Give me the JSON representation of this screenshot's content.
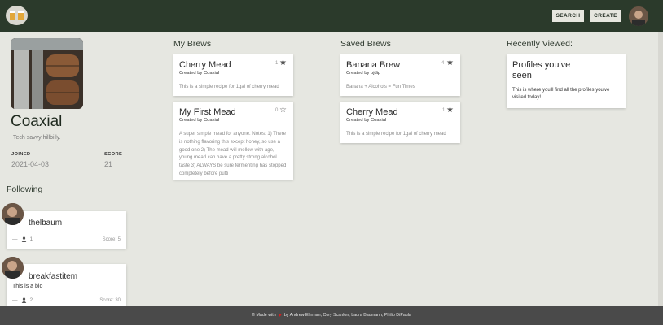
{
  "header": {
    "search_label": "SEARCH",
    "create_label": "CREATE"
  },
  "profile": {
    "username": "Coaxial",
    "bio": "Tech savvy hillbilly.",
    "joined_label": "JOINED",
    "joined_value": "2021-04-03",
    "score_label": "SCORE",
    "score_value": "21"
  },
  "following": {
    "title": "Following",
    "users": [
      {
        "name": "thelbaum",
        "bio": "",
        "followers": "1",
        "score": "Score: 5"
      },
      {
        "name": "breakfastitem",
        "bio": "This is a bio",
        "followers": "2",
        "score": "Score: 30"
      }
    ]
  },
  "my_brews": {
    "title": "My Brews",
    "items": [
      {
        "title": "Cherry Mead",
        "created_by": "Created by Coaxial",
        "description": "This is a simple recipe for 1gal of cherry mead",
        "stars": "1",
        "star_filled": true
      },
      {
        "title": "My First Mead",
        "created_by": "Created by Coaxial",
        "description": "A super simple mead for anyone. Notes: 1) There is nothing flavoring this except honey, so use a good one 2) The mead will mellow with age, young mead can have a pretty strong alcohol taste 3) ALWAYS be sure fermenting has stopped completely before putti",
        "stars": "0",
        "star_filled": false
      }
    ]
  },
  "saved_brews": {
    "title": "Saved Brews",
    "items": [
      {
        "title": "Banana Brew",
        "created_by": "Created by pjdip",
        "description": "Banana + Alcohols = Fun Times",
        "stars": "4",
        "star_filled": true
      },
      {
        "title": "Cherry Mead",
        "created_by": "Created by Coaxial",
        "description": "This is a simple recipe for 1gal of cherry mead",
        "stars": "1",
        "star_filled": true
      }
    ]
  },
  "recently_viewed": {
    "title": "Recently Viewed:",
    "card_title": "Profiles you've seen",
    "card_body": "This is where you'll find all the profiles you've visited today!"
  },
  "footer": {
    "made_with": "© Made with",
    "by_text": "by Andrew Ehrman, Cory Scanlon, Laura Baumann, Philip DiPaula"
  },
  "colors": {
    "topbar": "#2b3a2b",
    "background": "#e6e7e1",
    "footer": "#4a4a4a",
    "heart": "#d21f1f"
  }
}
